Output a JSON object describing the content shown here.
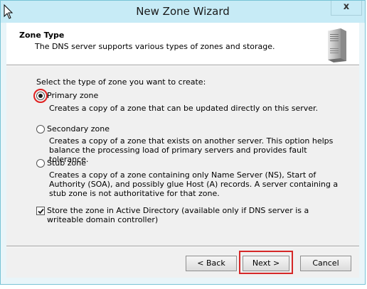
{
  "window": {
    "title": "New Zone Wizard",
    "close_glyph": "x"
  },
  "header": {
    "title": "Zone Type",
    "subtitle": "The DNS server supports various types of zones and storage."
  },
  "body": {
    "prompt": "Select the type of zone you want to create:",
    "options": [
      {
        "label": "Primary zone",
        "description": "Creates a copy of a zone that can be updated directly on this server.",
        "selected": true
      },
      {
        "label": "Secondary zone",
        "description": "Creates a copy of a zone that exists on another server. This option helps balance the processing load of primary servers and provides fault tolerance.",
        "selected": false
      },
      {
        "label": "Stub zone",
        "description": "Creates a copy of a zone containing only Name Server (NS), Start of Authority (SOA), and possibly glue Host (A) records. A server containing a stub zone is not authoritative for that zone.",
        "selected": false
      }
    ],
    "store_in_ad": {
      "label": "Store the zone in Active Directory (available only if DNS server is a writeable domain controller)",
      "checked": true
    }
  },
  "buttons": {
    "back": "< Back",
    "next": "Next >",
    "cancel": "Cancel"
  },
  "colors": {
    "title_bar": "#c7ebf6",
    "highlight": "#e02020"
  },
  "icons": {
    "server": "server-tower-icon",
    "cursor": "mouse-pointer-icon"
  }
}
